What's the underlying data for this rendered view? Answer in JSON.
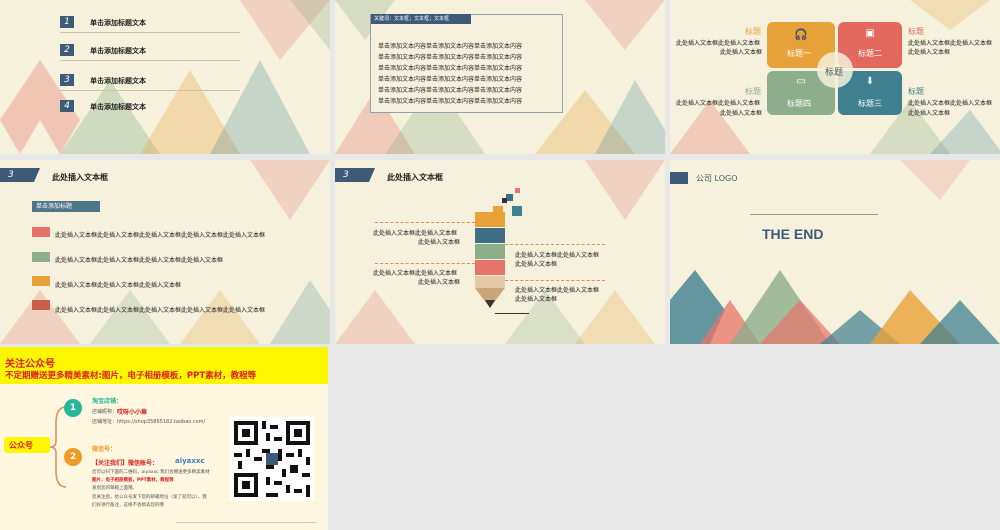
{
  "slide1": {
    "items": [
      {
        "num": "1",
        "label": "单击添加标题文本"
      },
      {
        "num": "2",
        "label": "单击添加标题文本"
      },
      {
        "num": "3",
        "label": "单击添加标题文本"
      },
      {
        "num": "4",
        "label": "单击添加标题文本"
      }
    ]
  },
  "slide2": {
    "keywords": "关键词：文本框；文本框；文本框",
    "lines": [
      "单击添加文本内容单击添加文本内容单击添加文本内容",
      "单击添加文本内容单击添加文本内容单击添加文本内容",
      "单击添加文本内容单击添加文本内容单击添加文本内容",
      "单击添加文本内容单击添加文本内容单击添加文本内容",
      "单击添加文本内容单击添加文本内容单击添加文本内容",
      "单击添加文本内容单击添加文本内容单击添加文本内容"
    ]
  },
  "slide3": {
    "center": "标题",
    "tiles": [
      "标题一",
      "标题二",
      "标题四",
      "标题三"
    ],
    "side_title": "标题",
    "side_text1": "此处插入文本框此处插入文本框",
    "side_text2": "此处插入文本框",
    "colors": [
      "#e8a23a",
      "#e3685e",
      "#8dae8a",
      "#3f7f8f"
    ]
  },
  "slide4": {
    "num": "3",
    "title": "此处插入文本框",
    "subtitle": "单击添加标题",
    "rows": [
      "此处插入文本框此处插入文本框此处插入文本框此处插入文本框此处插入文本框",
      "此处插入文本框此处插入文本框此处插入文本框此处插入文本框",
      "此处插入文本框此处插入文本框此处插入文本框",
      "此处插入文本框此处插入文本框此处插入文本框此处插入文本框此处插入文本框"
    ],
    "colors": [
      "#e8736a",
      "#8dae8a",
      "#e8a23a",
      "#c95f48"
    ]
  },
  "slide5": {
    "num": "3",
    "title": "此处插入文本框",
    "left1": "此处插入文本框此处插入文本框",
    "left1b": "此处插入文本框",
    "left2": "此处插入文本框此处插入文本框",
    "left2b": "此处插入文本框",
    "right1": "此处插入文本框此处插入文本框",
    "right1b": "此处插入文本框",
    "right2": "此处插入文本框此处插入文本框",
    "right2b": "此处插入文本框"
  },
  "slide6": {
    "logo": "公司 LOGO",
    "end": "THE END"
  },
  "promo": {
    "title": "关注公众号",
    "banner": "不定期赠送更多精美素材:图片，电子相册模板，PPT素材，教程等",
    "gzh": "公众号",
    "n1": "1",
    "n2": "2",
    "taobao_title": "淘宝店铺：",
    "taobao_name_label": "店铺昵称：",
    "taobao_name": "哎呀小小章",
    "taobao_url": "店铺地址：https://shop35865182.taobao.com/",
    "wx_title": "微信号：",
    "wx_line": "【关注我们】微信账号：",
    "wx_id": "aiyaxxc",
    "wx_desc1": "您可以扫下面的二维码，aiyaxxc 我们会赠送更多精美素材",
    "wx_desc2": "图片，电子相册模板，PPT素材，教程等",
    "wx_desc3": "发到您的邮箱上面哦。",
    "wx_desc4": "您关注后，给公众号发下您的邮箱地址（发了就可以），我",
    "wx_desc5": "们好进行备注，这样不会搞丢您的哦"
  }
}
